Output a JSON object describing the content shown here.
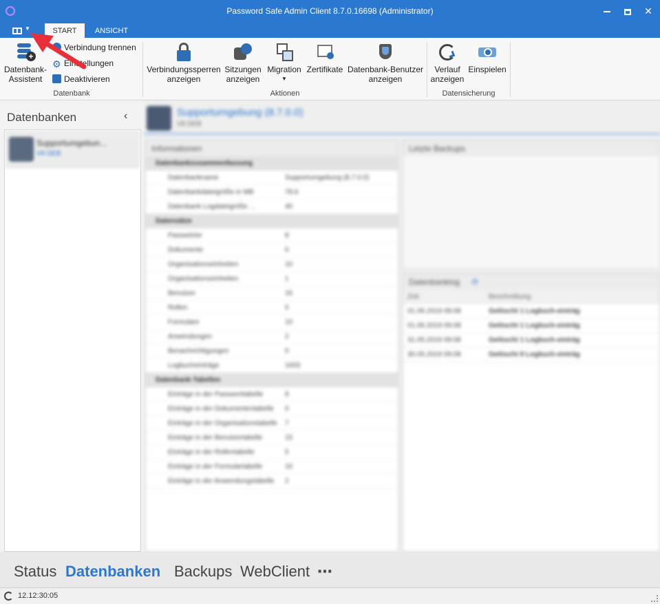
{
  "window": {
    "title": "Password Safe Admin Client 8.7.0.16698 (Administrator)"
  },
  "tabs": {
    "start": "START",
    "ansicht": "ANSICHT"
  },
  "ribbon": {
    "datenbank": {
      "wizard": "Datenbank-\nAssistent",
      "disconnect": "Verbindung trennen",
      "settings": "Einstellungen",
      "deactivate": "Deaktivieren",
      "group": "Datenbank"
    },
    "aktionen": {
      "locks": "Verbindungssperren\nanzeigen",
      "sessions": "Sitzungen\nanzeigen",
      "migration": "Migration",
      "certificates": "Zertifikate",
      "db_users": "Datenbank-Benutzer\nanzeigen",
      "group": "Aktionen"
    },
    "datensicherung": {
      "history": "Verlauf\nanzeigen",
      "restore": "Einspielen",
      "group": "Datensicherung"
    }
  },
  "left": {
    "title": "Datenbanken",
    "collapse": "‹",
    "item": {
      "name": "Supportumgebun...",
      "sub": "V8 DEB"
    }
  },
  "main": {
    "title": "Supportumgebung (8.7.0.0)",
    "sub": "V8 DEB",
    "info_header": "Informationen",
    "sections": [
      {
        "label": "Datenbankzusammenfassung",
        "rows": [
          [
            "Datenbankname",
            "Supportumgebung (8.7.0.0)"
          ],
          [
            "Datenbankdateigröße in MB",
            "78.6"
          ],
          [
            "Datenbank Logdateigröße ...",
            "40"
          ]
        ]
      },
      {
        "label": "Datensätze",
        "rows": [
          [
            "Passwörter",
            "8"
          ],
          [
            "Dokumente",
            "0"
          ],
          [
            "Organisationseinheiten",
            "10"
          ],
          [
            "Organisationseinheiten",
            "1"
          ],
          [
            "Benutzer",
            "16"
          ],
          [
            "Rollen",
            "5"
          ],
          [
            "Formulare",
            "10"
          ],
          [
            "Anwendungen",
            "2"
          ],
          [
            "Benachrichtigungen",
            "0"
          ],
          [
            "Logbucheinträge",
            "1003"
          ]
        ]
      },
      {
        "label": "Datenbank-Tabellen",
        "rows": [
          [
            "Einträge in der Passworttabelle",
            "8"
          ],
          [
            "Einträge in der Dokumententabelle",
            "0"
          ],
          [
            "Einträge in der Organisationstabelle",
            "7"
          ],
          [
            "Einträge in der Benutzertabelle",
            "15"
          ],
          [
            "Einträge in der Rollentabelle",
            "5"
          ],
          [
            "Einträge in der Formulartabelle",
            "10"
          ],
          [
            "Einträge in der Anwendungstabelle",
            "2"
          ]
        ]
      }
    ],
    "backups_header": "Letzte Backups",
    "logs_header": "Datenbanklog",
    "logs_columns": [
      "Zeit",
      "Beschreibung"
    ],
    "logs": [
      [
        "01.06.2019 09:08",
        "Gelöscht 1 Logbuch-einträg"
      ],
      [
        "01.06.2019 09:08",
        "Gelöscht 1 Logbuch-einträg"
      ],
      [
        "31.05.2019 09:08",
        "Gelöscht 1 Logbuch-einträg"
      ],
      [
        "30.05.2019 09:08",
        "Gelöscht 8 Logbuch-einträg"
      ]
    ]
  },
  "bottom_nav": {
    "status": "Status",
    "datenbanken": "Datenbanken",
    "backups": "Backups",
    "webclient": "WebClient",
    "more": "⋯"
  },
  "statusbar": {
    "time": "12.12:30:05"
  },
  "colors": {
    "accent": "#2b78d0",
    "annotation": "#e8303a"
  }
}
